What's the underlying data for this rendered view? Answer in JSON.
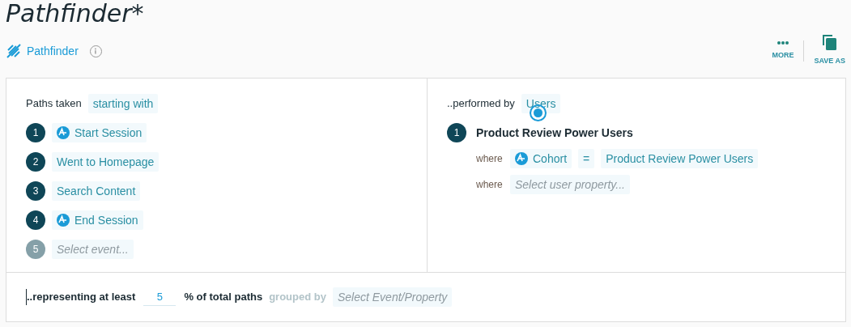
{
  "title": "Pathfinder*",
  "chart_label": "Pathfinder",
  "actions": [
    {
      "kind": "more",
      "label": "MORE"
    },
    {
      "kind": "save",
      "label": "SAVE AS"
    }
  ],
  "paths": {
    "label": "Paths taken",
    "mode": "starting with",
    "steps": [
      {
        "number": "1",
        "kind": "builtin",
        "event": "Start Session"
      },
      {
        "number": "2",
        "kind": "custom",
        "event": "Went to Homepage"
      },
      {
        "number": "3",
        "kind": "custom",
        "event": "Search Content"
      },
      {
        "number": "4",
        "kind": "builtin",
        "event": "End Session"
      },
      {
        "number": "5",
        "kind": "empty",
        "placeholder": "Select event..."
      }
    ]
  },
  "segment": {
    "label": "..performed by",
    "subject": "Users",
    "groups": [
      {
        "number": "1",
        "name": "Product Review Power Users",
        "filters": [
          {
            "kind": "filter",
            "word": "where",
            "property": "Cohort",
            "operator": "=",
            "value": "Product Review Power Users"
          },
          {
            "kind": "empty",
            "word": "where",
            "placeholder": "Select user property..."
          }
        ]
      }
    ]
  },
  "footer": {
    "prefix": "..representing at least",
    "value": "5",
    "suffix": "% of total paths",
    "group_label": "grouped by",
    "group_placeholder": "Select Event/Property"
  }
}
